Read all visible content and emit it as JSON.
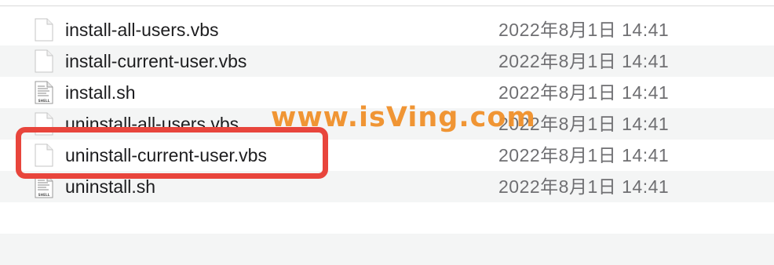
{
  "files": [
    {
      "name": "install-all-users.vbs",
      "date": "2022年8月1日 14:41",
      "icon": "document-icon"
    },
    {
      "name": "install-current-user.vbs",
      "date": "2022年8月1日 14:41",
      "icon": "document-icon"
    },
    {
      "name": "install.sh",
      "date": "2022年8月1日 14:41",
      "icon": "shell-script-icon"
    },
    {
      "name": "uninstall-all-users.vbs",
      "date": "2022年8月1日 14:41",
      "icon": "document-icon"
    },
    {
      "name": "uninstall-current-user.vbs",
      "date": "2022年8月1日 14:41",
      "icon": "document-icon"
    },
    {
      "name": "uninstall.sh",
      "date": "2022年8月1日 14:41",
      "icon": "shell-script-icon"
    }
  ],
  "shell_icon_label": "SHELL",
  "watermark": "www.isVing.com",
  "colors": {
    "highlight": "#e8453c",
    "watermark": "#f0902a",
    "row_alt": "#f4f5f5"
  }
}
